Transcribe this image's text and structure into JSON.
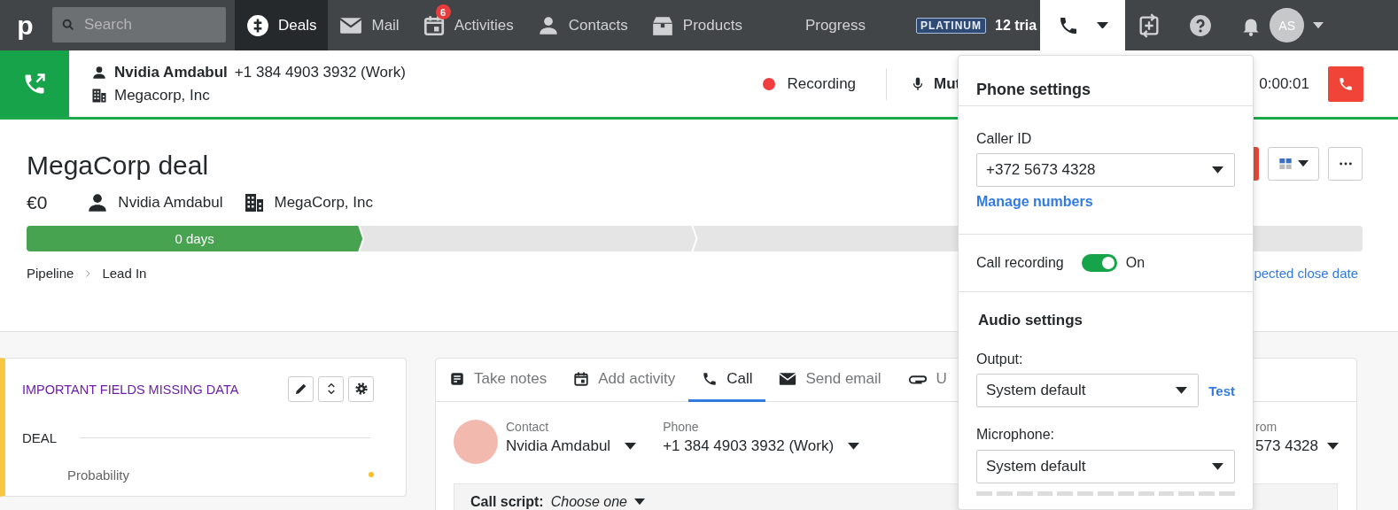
{
  "topbar": {
    "logo": "p",
    "search": {
      "placeholder": "Search"
    },
    "nav": [
      {
        "label": "Deals",
        "selected": true
      },
      {
        "label": "Mail",
        "selected": false
      },
      {
        "label": "Activities",
        "badge": "6",
        "selected": false
      },
      {
        "label": "Contacts",
        "selected": false
      },
      {
        "label": "Products",
        "selected": false
      },
      {
        "label": "Progress",
        "selected": false
      }
    ],
    "plan_badge": "PLATINUM",
    "trial_text": "12 tria",
    "phone_menu": {
      "expanded": true
    },
    "avatar": "AS"
  },
  "call_bar": {
    "contact_name": "Nvidia Amdabul",
    "phone": "+1 384 4903 3932 (Work)",
    "company": "Megacorp, Inc",
    "recording": "Recording",
    "mute": "Mut",
    "timer": "0:00:01"
  },
  "deal": {
    "title": "MegaCorp deal",
    "value": "€0",
    "person": "Nvidia Amdabul",
    "organization": "MegaCorp, Inc",
    "stages": [
      {
        "label": "0 days",
        "selected": true
      },
      {
        "selected": false
      },
      {
        "selected": false
      },
      {
        "selected": false
      }
    ],
    "breadcrumb": [
      "Pipeline",
      "Lead In"
    ],
    "close_date_link": "pected close date"
  },
  "fields_card": {
    "title": "IMPORTANT FIELDS MISSING DATA",
    "section": "DEAL",
    "fields": [
      "Probability"
    ]
  },
  "call_panel": {
    "tabs": [
      {
        "label": "Take notes",
        "selected": false
      },
      {
        "label": "Add activity",
        "selected": false
      },
      {
        "label": "Call",
        "selected": true
      },
      {
        "label": "Send email",
        "selected": false
      },
      {
        "label": "U",
        "selected": false
      }
    ],
    "contact_label": "Contact",
    "contact": "Nvidia Amdabul",
    "phone_label": "Phone",
    "phone": "+1 384 4903 3932 (Work)",
    "from_label": "rom",
    "from": "573 4328",
    "script_label": "Call script:",
    "script_value": "Choose one"
  },
  "phone_settings": {
    "title": "Phone settings",
    "caller_id_label": "Caller ID",
    "caller_id": "+372 5673 4328",
    "manage_link": "Manage numbers",
    "recording_label": "Call recording",
    "recording_on": true,
    "recording_state": "On",
    "audio_title": "Audio settings",
    "output_label": "Output:",
    "output": "System default",
    "test_link": "Test",
    "microphone_label": "Microphone:",
    "microphone": "System default"
  }
}
